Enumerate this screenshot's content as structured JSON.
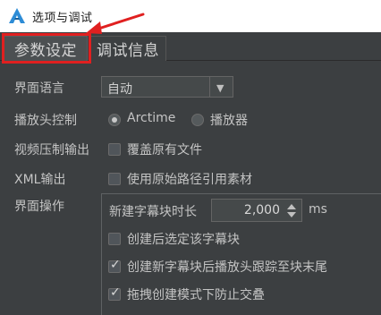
{
  "window": {
    "title": "选项与调试"
  },
  "tabs": [
    {
      "label": "参数设定"
    },
    {
      "label": "调试信息"
    }
  ],
  "settings": {
    "language": {
      "label": "界面语言",
      "value": "自动"
    },
    "playhead": {
      "label": "播放头控制",
      "options": [
        {
          "label": "Arctime",
          "selected": true
        },
        {
          "label": "播放器",
          "selected": false
        }
      ]
    },
    "video_compress": {
      "label": "视频压制输出",
      "checkbox": {
        "label": "覆盖原有文件",
        "checked": false
      }
    },
    "xml_output": {
      "label": "XML输出",
      "checkbox": {
        "label": "使用原始路径引用素材",
        "checked": false
      }
    },
    "ui_ops": {
      "label": "界面操作",
      "new_subtitle_duration": {
        "label": "新建字幕块时长",
        "value": "2,000",
        "unit": "ms"
      },
      "checkboxes": [
        {
          "label": "创建后选定该字幕块",
          "checked": false
        },
        {
          "label": "创建新字幕块后播放头跟踪至块末尾",
          "checked": true
        },
        {
          "label": "拖拽创建模式下防止交叠",
          "checked": true
        }
      ]
    }
  },
  "colors": {
    "annotation": "#e02020",
    "background": "#3c3f41"
  },
  "icons": {
    "app": "arctime-logo-icon",
    "annotation_arrow": "red-arrow-icon"
  }
}
